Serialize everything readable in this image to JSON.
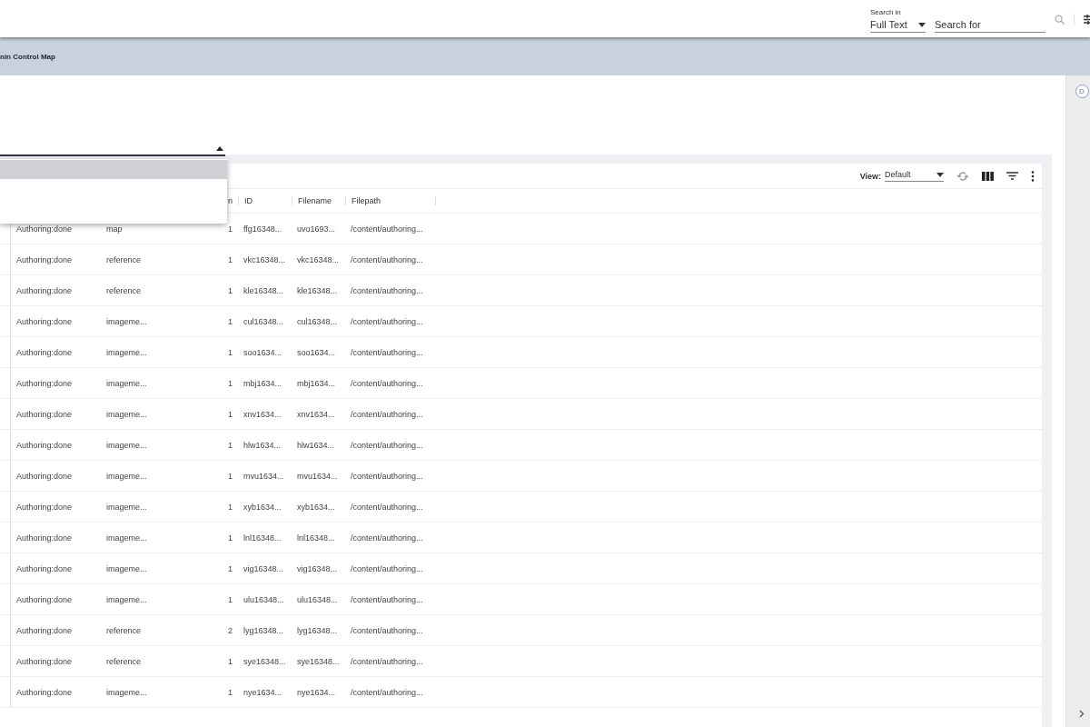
{
  "search": {
    "label": "Search in",
    "scope": "Full Text",
    "placeholder": "Search for"
  },
  "banner": {
    "title": "nin Control Map"
  },
  "side_panel": {
    "avatar": "D"
  },
  "dropdown": {
    "expanded": true,
    "options": [
      {
        "selected": true
      },
      {
        "selected": false
      }
    ]
  },
  "table": {
    "view_label": "View:",
    "view": "Default",
    "columns": [
      "n",
      "ID",
      "Filename",
      "Filepath"
    ],
    "rows": [
      {
        "status": "Authoring:done",
        "type": "map",
        "version": "1",
        "id": "ffg16348...",
        "filename": "uvo1693...",
        "filepath": "/content/authoring..."
      },
      {
        "status": "Authoring:done",
        "type": "reference",
        "version": "1",
        "id": "vkc16348...",
        "filename": "vkc16348...",
        "filepath": "/content/authoring..."
      },
      {
        "status": "Authoring:done",
        "type": "reference",
        "version": "1",
        "id": "kle16348...",
        "filename": "kle16348...",
        "filepath": "/content/authoring..."
      },
      {
        "status": "Authoring:done",
        "type": "imageme...",
        "version": "1",
        "id": "cul16348...",
        "filename": "cul16348...",
        "filepath": "/content/authoring..."
      },
      {
        "status": "Authoring:done",
        "type": "imageme...",
        "version": "1",
        "id": "soo1634...",
        "filename": "soo1634...",
        "filepath": "/content/authoring..."
      },
      {
        "status": "Authoring:done",
        "type": "imageme...",
        "version": "1",
        "id": "mbj1634...",
        "filename": "mbj1634...",
        "filepath": "/content/authoring..."
      },
      {
        "status": "Authoring:done",
        "type": "imageme...",
        "version": "1",
        "id": "xnv1634...",
        "filename": "xnv1634...",
        "filepath": "/content/authoring..."
      },
      {
        "status": "Authoring:done",
        "type": "imageme...",
        "version": "1",
        "id": "hlw1634...",
        "filename": "hlw1634...",
        "filepath": "/content/authoring..."
      },
      {
        "status": "Authoring:done",
        "type": "imageme...",
        "version": "1",
        "id": "mvu1634...",
        "filename": "mvu1634...",
        "filepath": "/content/authoring..."
      },
      {
        "status": "Authoring:done",
        "type": "imageme...",
        "version": "1",
        "id": "xyb1634...",
        "filename": "xyb1634...",
        "filepath": "/content/authoring..."
      },
      {
        "status": "Authoring:done",
        "type": "imageme...",
        "version": "1",
        "id": "lnl16348...",
        "filename": "lnl16348...",
        "filepath": "/content/authoring..."
      },
      {
        "status": "Authoring:done",
        "type": "imageme...",
        "version": "1",
        "id": "vig16348...",
        "filename": "vig16348...",
        "filepath": "/content/authoring..."
      },
      {
        "status": "Authoring:done",
        "type": "imageme...",
        "version": "1",
        "id": "ulu16348...",
        "filename": "ulu16348...",
        "filepath": "/content/authoring..."
      },
      {
        "status": "Authoring:done",
        "type": "reference",
        "version": "2",
        "id": "lyg16348...",
        "filename": "lyg16348...",
        "filepath": "/content/authoring..."
      },
      {
        "status": "Authoring:done",
        "type": "reference",
        "version": "1",
        "id": "sye16348...",
        "filename": "sye16348...",
        "filepath": "/content/authoring..."
      },
      {
        "status": "Authoring:done",
        "type": "imageme...",
        "version": "1",
        "id": "nye1634...",
        "filename": "nye1634...",
        "filepath": "/content/authoring..."
      }
    ]
  }
}
